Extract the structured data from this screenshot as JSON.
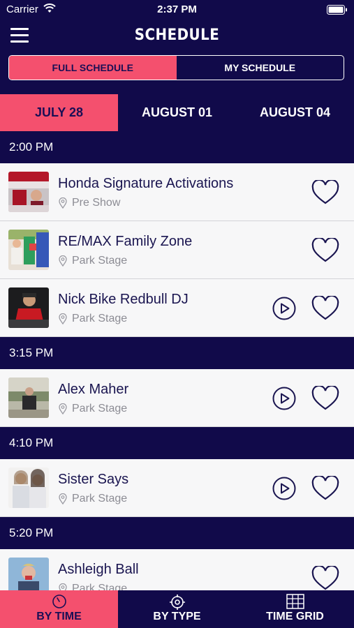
{
  "status_bar": {
    "carrier": "Carrier",
    "time": "2:37 PM"
  },
  "header": {
    "title": "SCHEDULE"
  },
  "segment": {
    "full": "FULL SCHEDULE",
    "mine": "MY SCHEDULE",
    "selected": "full"
  },
  "date_tabs": [
    "JULY 28",
    "AUGUST 01",
    "AUGUST 04"
  ],
  "groups": [
    {
      "time": "2:00 PM",
      "items": [
        {
          "name": "Honda Signature Activations",
          "venue": "Pre Show",
          "has_play": false
        },
        {
          "name": "RE/MAX Family Zone",
          "venue": "Park Stage",
          "has_play": false
        },
        {
          "name": "Nick Bike Redbull DJ",
          "venue": "Park Stage",
          "has_play": true
        }
      ]
    },
    {
      "time": "3:15 PM",
      "items": [
        {
          "name": "Alex Maher",
          "venue": "Park Stage",
          "has_play": true
        }
      ]
    },
    {
      "time": "4:10 PM",
      "items": [
        {
          "name": "Sister Says",
          "venue": "Park Stage",
          "has_play": true
        }
      ]
    },
    {
      "time": "5:20 PM",
      "items": [
        {
          "name": "Ashleigh Ball",
          "venue": "Park Stage",
          "has_play": false
        }
      ]
    }
  ],
  "tabbar": {
    "by_time": "BY TIME",
    "by_type": "BY TYPE",
    "time_grid": "TIME GRID"
  },
  "colors": {
    "navy": "#110a4a",
    "accent": "#f4506e",
    "row_bg": "#f7f7f8",
    "text_dark": "#1a1550",
    "muted": "#8c8c94"
  }
}
